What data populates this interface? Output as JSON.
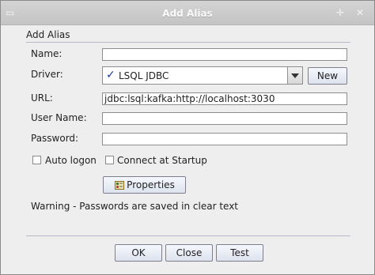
{
  "window": {
    "title": "Add Alias",
    "menu_icon": "window-menu-icon",
    "pin_icon": "pin-icon",
    "close_icon": "close-icon"
  },
  "form": {
    "group_title": "Add Alias",
    "name_label": "Name:",
    "name_value": "",
    "driver_label": "Driver:",
    "driver_value": "LSQL JDBC",
    "new_button": "New",
    "url_label": "URL:",
    "url_value": "jdbc:lsql:kafka:http://localhost:3030",
    "user_label": "User Name:",
    "user_value": "",
    "password_label": "Password:",
    "password_value": "",
    "auto_logon_label": "Auto logon",
    "auto_logon_checked": false,
    "connect_startup_label": "Connect at Startup",
    "connect_startup_checked": false,
    "properties_button": "Properties",
    "warning": "Warning - Passwords are saved in clear text"
  },
  "buttons": {
    "ok": "OK",
    "close": "Close",
    "test": "Test"
  }
}
